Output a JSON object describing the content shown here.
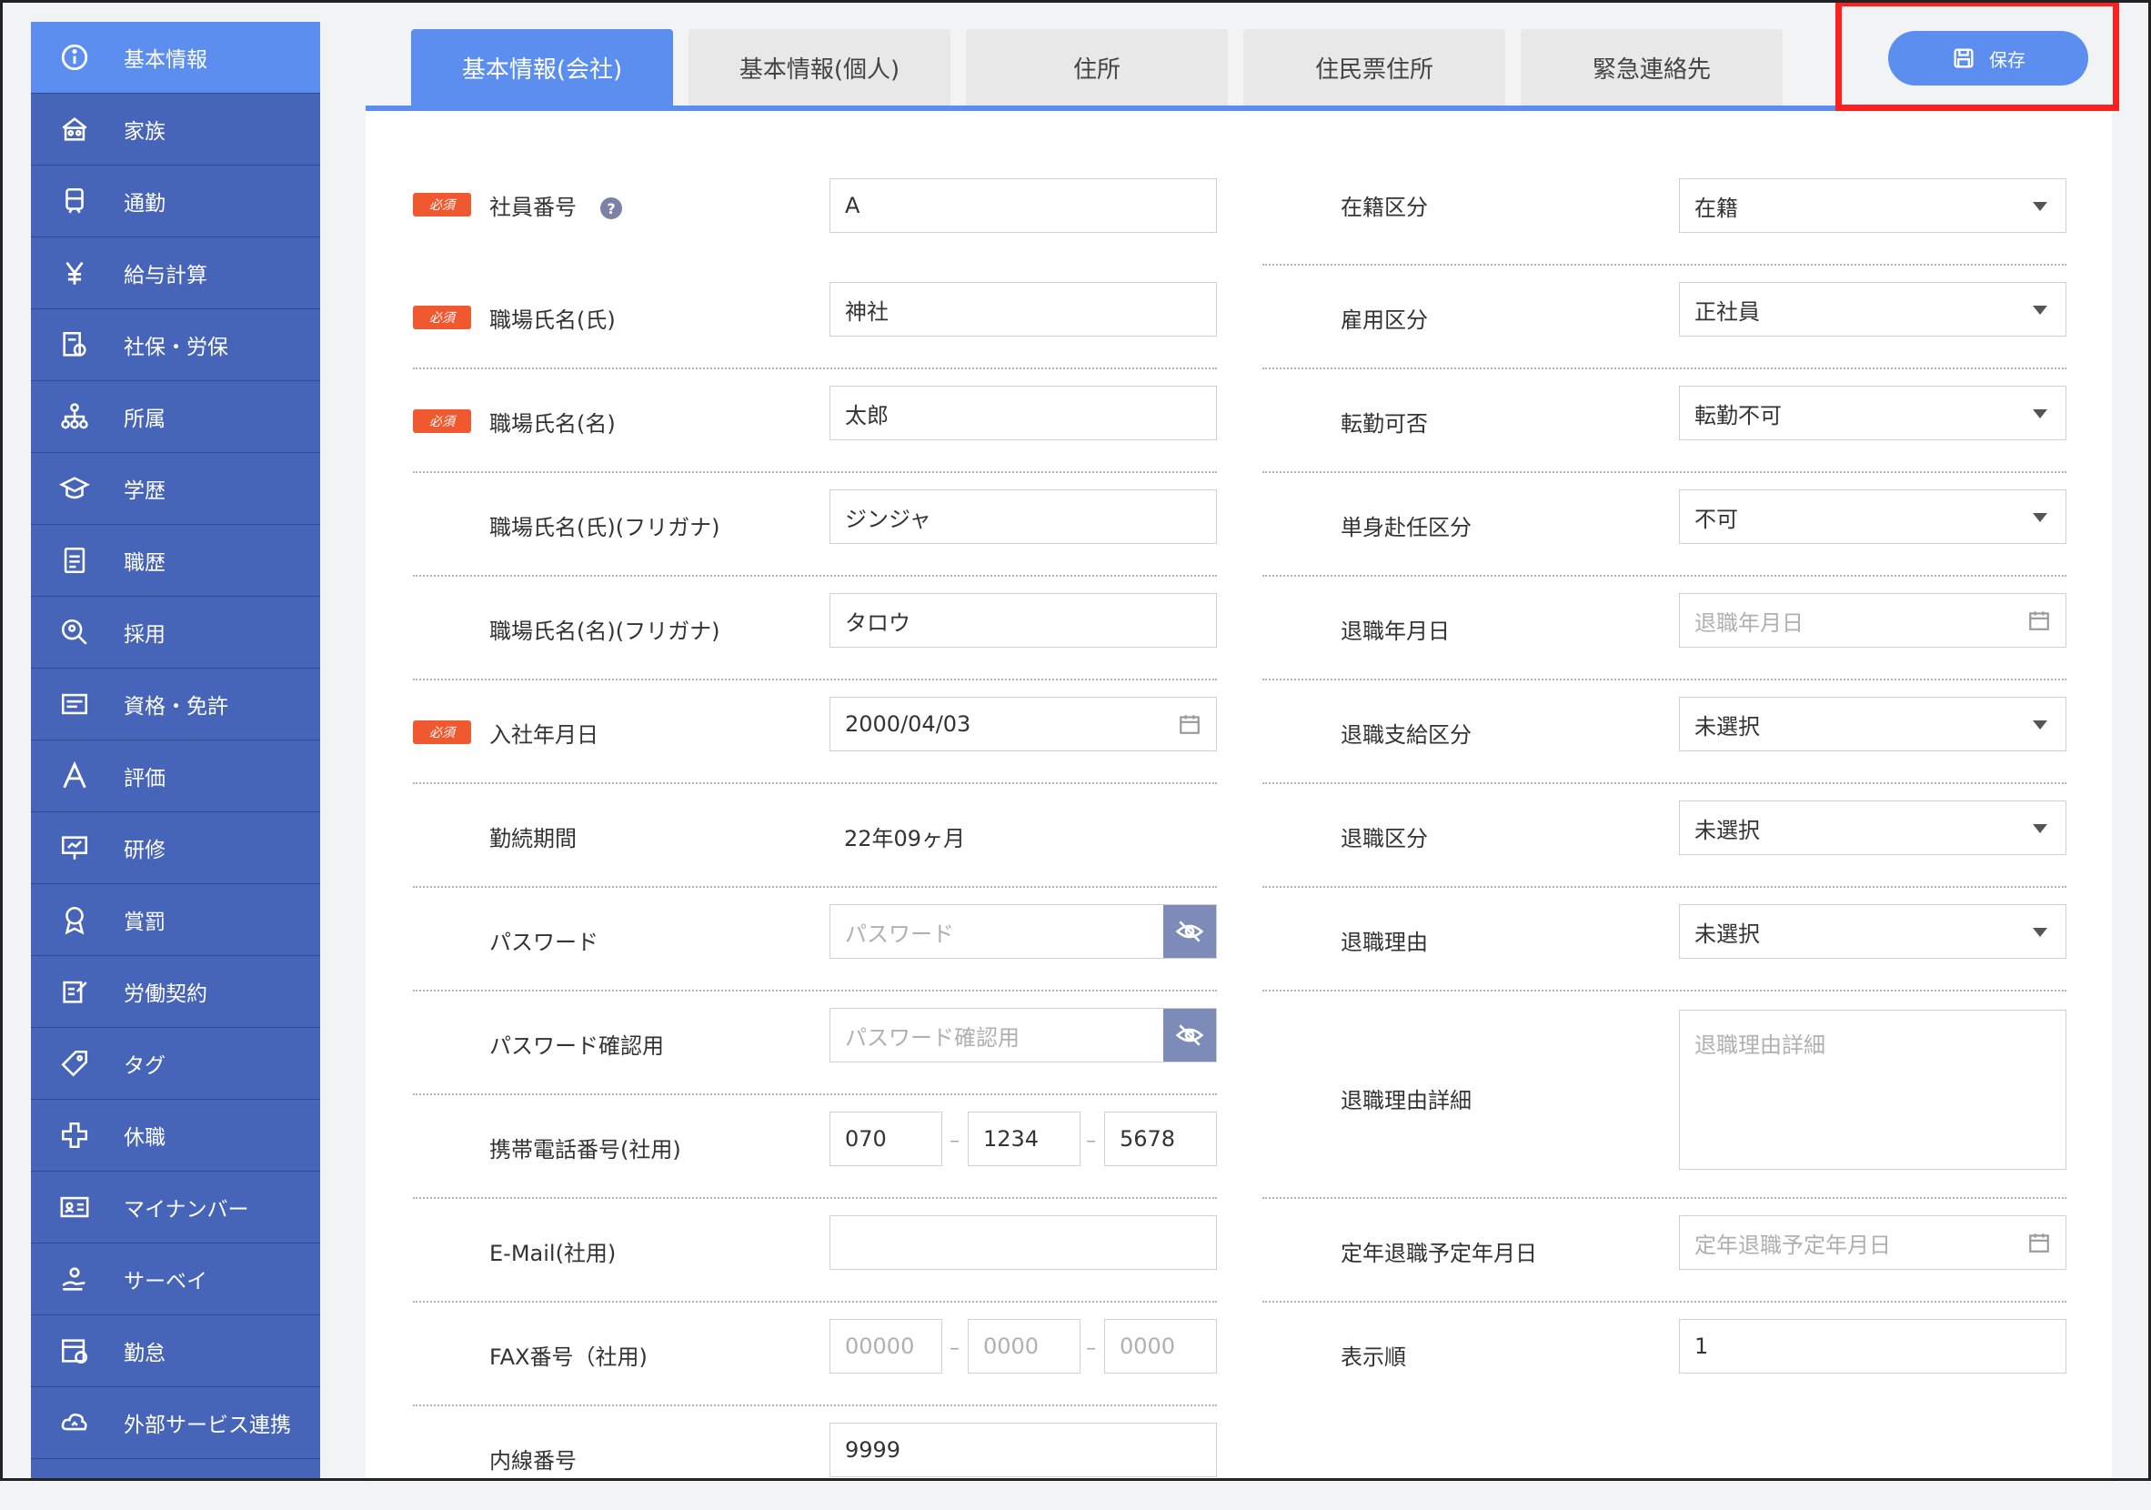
{
  "sidebar": {
    "items": [
      {
        "label": "基本情報",
        "icon": "info-icon"
      },
      {
        "label": "家族",
        "icon": "family-house-icon"
      },
      {
        "label": "通勤",
        "icon": "train-icon"
      },
      {
        "label": "給与計算",
        "icon": "yen-icon"
      },
      {
        "label": "社保・労保",
        "icon": "insurance-icon"
      },
      {
        "label": "所属",
        "icon": "org-chart-icon"
      },
      {
        "label": "学歴",
        "icon": "graduation-cap-icon"
      },
      {
        "label": "職歴",
        "icon": "career-document-icon"
      },
      {
        "label": "採用",
        "icon": "recruit-search-icon"
      },
      {
        "label": "資格・免許",
        "icon": "license-card-icon"
      },
      {
        "label": "評価",
        "icon": "evaluation-a-icon"
      },
      {
        "label": "研修",
        "icon": "training-board-icon"
      },
      {
        "label": "賞罰",
        "icon": "award-medal-icon"
      },
      {
        "label": "労働契約",
        "icon": "contract-edit-icon"
      },
      {
        "label": "タグ",
        "icon": "tag-icon"
      },
      {
        "label": "休職",
        "icon": "leave-cross-icon"
      },
      {
        "label": "マイナンバー",
        "icon": "id-card-icon"
      },
      {
        "label": "サーベイ",
        "icon": "survey-hand-icon"
      },
      {
        "label": "勤怠",
        "icon": "attendance-calendar-icon"
      },
      {
        "label": "外部サービス連携",
        "icon": "cloud-sync-icon"
      }
    ]
  },
  "tabs": [
    "基本情報(会社)",
    "基本情報(個人)",
    "住所",
    "住民票住所",
    "緊急連絡先"
  ],
  "save_label": "保存",
  "required_label": "必須",
  "left": {
    "employee_no": {
      "label": "社員番号",
      "value": "A"
    },
    "last_name": {
      "label": "職場氏名(氏)",
      "value": "神社"
    },
    "first_name": {
      "label": "職場氏名(名)",
      "value": "太郎"
    },
    "last_kana": {
      "label": "職場氏名(氏)(フリガナ)",
      "value": "ジンジャ"
    },
    "first_kana": {
      "label": "職場氏名(名)(フリガナ)",
      "value": "タロウ"
    },
    "join_date": {
      "label": "入社年月日",
      "value": "2000/04/03"
    },
    "tenure": {
      "label": "勤続期間",
      "value": "22年09ヶ月"
    },
    "password": {
      "label": "パスワード",
      "placeholder": "パスワード"
    },
    "password_confirm": {
      "label": "パスワード確認用",
      "placeholder": "パスワード確認用"
    },
    "mobile": {
      "label": "携帯電話番号(社用)",
      "p1": "070",
      "p2": "1234",
      "p3": "5678"
    },
    "email": {
      "label": "E-Mail(社用)",
      "value": ""
    },
    "fax": {
      "label": "FAX番号（社用)",
      "p1": "00000",
      "p2": "0000",
      "p3": "0000"
    },
    "extension": {
      "label": "内線番号",
      "value": "9999"
    }
  },
  "right": {
    "enrollment": {
      "label": "在籍区分",
      "value": "在籍"
    },
    "employment": {
      "label": "雇用区分",
      "value": "正社員"
    },
    "transfer": {
      "label": "転勤可否",
      "value": "転勤不可"
    },
    "single_assign": {
      "label": "単身赴任区分",
      "value": "不可"
    },
    "retire_date": {
      "label": "退職年月日",
      "placeholder": "退職年月日"
    },
    "retire_pay": {
      "label": "退職支給区分",
      "value": "未選択"
    },
    "retire_type": {
      "label": "退職区分",
      "value": "未選択"
    },
    "retire_reason": {
      "label": "退職理由",
      "value": "未選択"
    },
    "retire_detail": {
      "label": "退職理由詳細",
      "placeholder": "退職理由詳細"
    },
    "retire_planned": {
      "label": "定年退職予定年月日",
      "placeholder": "定年退職予定年月日"
    },
    "display_order": {
      "label": "表示順",
      "value": "1"
    }
  },
  "colors": {
    "sidebar": "#4664b8",
    "accent": "#5c8ef0",
    "required": "#f0582f",
    "highlight": "#ff1f1f"
  }
}
